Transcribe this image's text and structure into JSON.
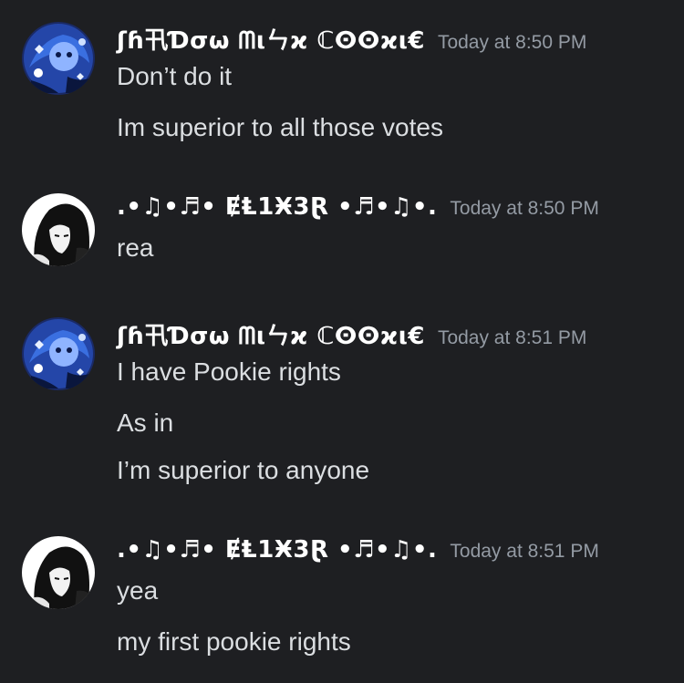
{
  "messages": [
    {
      "author": "ʃɦ卂Ɗσω ᗰ⍳ㄣϰ ℂⵙⵙϰ⍳€",
      "timestamp": "Today at 8:50 PM",
      "avatar": "blue-cookie-avatar",
      "lines": [
        "Don’t do it",
        "Im superior to all those votes"
      ]
    },
    {
      "author": ".•♫•♬• ɆⱠ1Ӿ3Ɽ •♬•♫•.",
      "timestamp": "Today at 8:50 PM",
      "avatar": "black-white-anime-avatar",
      "lines": [
        "rea"
      ]
    },
    {
      "author": "ʃɦ卂Ɗσω ᗰ⍳ㄣϰ ℂⵙⵙϰ⍳€",
      "timestamp": "Today at 8:51 PM",
      "avatar": "blue-cookie-avatar",
      "lines": [
        "I have Pookie rights",
        "As in",
        "I’m superior to anyone"
      ]
    },
    {
      "author": ".•♫•♬• ɆⱠ1Ӿ3Ɽ •♬•♫•.",
      "timestamp": "Today at 8:51 PM",
      "avatar": "black-white-anime-avatar",
      "lines": [
        "yea",
        "my first pookie rights"
      ]
    }
  ],
  "colors": {
    "background": "#1e1f22",
    "username": "#ffffff",
    "timestamp": "#949ba4",
    "message_text": "#dbdee1"
  }
}
